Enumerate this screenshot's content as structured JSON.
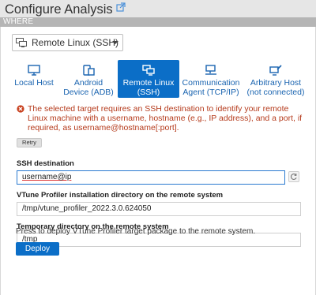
{
  "header": {
    "title": "Configure Analysis",
    "title_icon": "external-link-icon"
  },
  "section": {
    "label": "WHERE"
  },
  "target_select": {
    "value": "Remote Linux (SSH)",
    "icon": "remote-linux-icon"
  },
  "targets": [
    {
      "label": "Local Host",
      "icon": "monitor-icon",
      "active": false
    },
    {
      "label": "Android Device (ADB)",
      "icon": "android-device-icon",
      "active": false
    },
    {
      "label": "Remote Linux (SSH)",
      "icon": "remote-linux-icon",
      "active": true
    },
    {
      "label": "Communication Agent (TCP/IP)",
      "icon": "communication-agent-icon",
      "active": false
    },
    {
      "label": "Arbitrary Host (not connected)",
      "icon": "arbitrary-host-icon",
      "active": false
    }
  ],
  "error": {
    "message": "The selected target requires an SSH destination to identify your remote Linux machine with a username, hostname (e.g., IP address), and a port, if required, as username@hostname[:port].",
    "color": "#b53a1b"
  },
  "retry_label": "Retry",
  "ssh": {
    "label": "SSH destination",
    "value": "username@ip"
  },
  "install_dir": {
    "label": "VTune Profiler installation directory on the remote system",
    "value": "/tmp/vtune_profiler_2022.3.0.624050"
  },
  "temp_dir": {
    "label": "Temporary directory on the remote system",
    "value": "/tmp"
  },
  "deploy": {
    "text": "Press to deploy VTune Profiler target package to the remote system.",
    "button_label": "Deploy"
  },
  "colors": {
    "accent": "#0b6ec7",
    "link": "#1a64b0",
    "error": "#b53a1b"
  }
}
